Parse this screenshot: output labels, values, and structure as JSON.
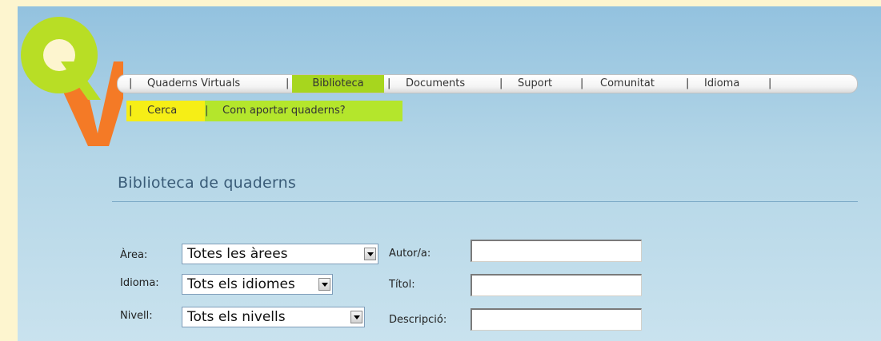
{
  "colors": {
    "nav_active": "#a7d61e",
    "subnav_active": "#f6ee16",
    "subnav_item": "#b4e62c",
    "title": "#3a5c78",
    "logo_q": "#b8de25",
    "logo_v": "#f47a26"
  },
  "logo": {
    "letters": "QV",
    "icon": "qv-logo-icon"
  },
  "nav": {
    "separator": "|",
    "items": [
      {
        "label": "Quaderns Virtuals"
      },
      {
        "label": "Biblioteca",
        "active": true
      },
      {
        "label": "Documents"
      },
      {
        "label": "Suport"
      },
      {
        "label": "Comunitat"
      },
      {
        "label": "Idioma"
      }
    ]
  },
  "subnav": {
    "items": [
      {
        "label": "Cerca",
        "active": true
      },
      {
        "label": "Com aportar quaderns?"
      }
    ]
  },
  "section": {
    "title": "Biblioteca de quaderns"
  },
  "form": {
    "area": {
      "label": "Àrea:",
      "value": "Totes les àrees"
    },
    "idioma": {
      "label": "Idioma:",
      "value": "Tots els idiomes"
    },
    "nivell": {
      "label": "Nivell:",
      "value": "Tots els nivells"
    },
    "autor": {
      "label": "Autor/a:",
      "value": ""
    },
    "titol": {
      "label": "Títol:",
      "value": ""
    },
    "descripcio": {
      "label": "Descripció:",
      "value": ""
    }
  }
}
